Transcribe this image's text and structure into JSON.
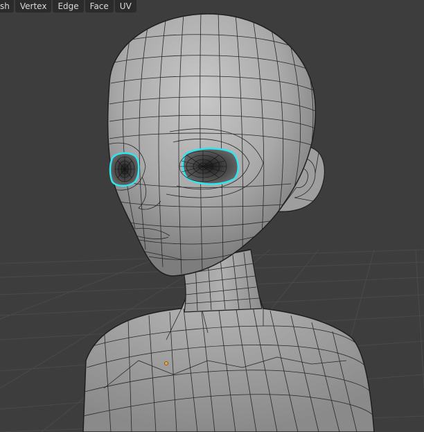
{
  "editor": {
    "mode": "Edit Mode",
    "menus": [
      "sh",
      "Vertex",
      "Edge",
      "Face",
      "UV"
    ]
  },
  "viewport": {
    "object": "head-and-torso-mesh",
    "selection_color": "#2ee6f0",
    "background_color": "#3d3d3d",
    "mesh_color": "#a2a2a2",
    "wire_color": "#222222"
  }
}
